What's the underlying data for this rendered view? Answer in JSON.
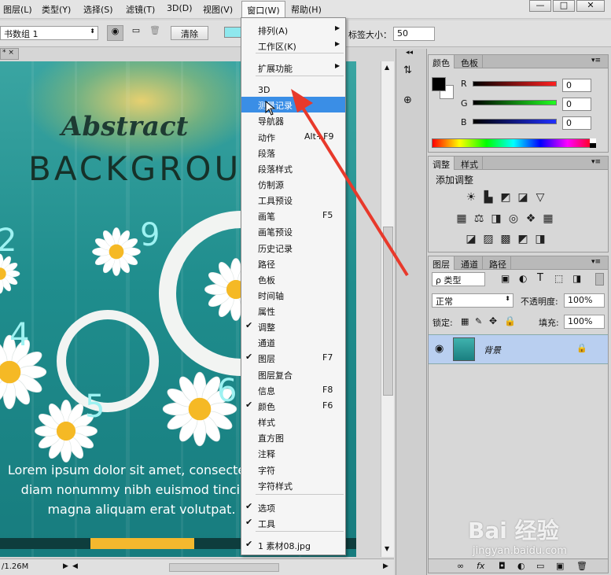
{
  "menubar": {
    "items": [
      "图层(L)",
      "类型(Y)",
      "选择(S)",
      "滤镜(T)",
      "3D(D)",
      "视图(V)",
      "窗口(W)",
      "帮助(H)"
    ],
    "window_controls": [
      "—",
      "□",
      "✕"
    ]
  },
  "options": {
    "group_value": "书数组 1",
    "clear_button": "清除",
    "tab_size_label": "标签大小：",
    "tab_size_value": "50"
  },
  "document": {
    "tab_label": "* ×",
    "status_text": "/1.26M"
  },
  "artwork": {
    "title_script": "Abstract",
    "title_block": "BACKGROUND",
    "numbers": [
      "2",
      "9",
      "4",
      "5",
      "6"
    ],
    "lorem_lines": [
      "Lorem ipsum dolor sit amet, consectetuer ad",
      "diam nonummy nibh euismod tincidunt ut",
      "magna aliquam erat volutpat."
    ]
  },
  "window_menu": {
    "items": [
      {
        "label": "排列(A)",
        "arrow": "▶"
      },
      {
        "label": "工作区(K)",
        "arrow": "▶"
      },
      {
        "label": "扩展功能",
        "arrow": "▶"
      },
      {
        "label": "3D"
      },
      {
        "label": "测量记录"
      },
      {
        "label": "导航器"
      },
      {
        "label": "动作",
        "shortcut": "Alt+F9"
      },
      {
        "label": "段落"
      },
      {
        "label": "段落样式"
      },
      {
        "label": "仿制源"
      },
      {
        "label": "工具预设"
      },
      {
        "label": "画笔",
        "shortcut": "F5"
      },
      {
        "label": "画笔预设"
      },
      {
        "label": "历史记录"
      },
      {
        "label": "路径"
      },
      {
        "label": "色板"
      },
      {
        "label": "时间轴"
      },
      {
        "label": "属性"
      },
      {
        "label": "调整",
        "check": "✔"
      },
      {
        "label": "通道"
      },
      {
        "label": "图层",
        "shortcut": "F7",
        "check": "✔"
      },
      {
        "label": "图层复合"
      },
      {
        "label": "信息",
        "shortcut": "F8"
      },
      {
        "label": "颜色",
        "shortcut": "F6",
        "check": "✔"
      },
      {
        "label": "样式"
      },
      {
        "label": "直方图"
      },
      {
        "label": "注释"
      },
      {
        "label": "字符"
      },
      {
        "label": "字符样式"
      },
      {
        "label": "选项",
        "check": "✔"
      },
      {
        "label": "工具",
        "check": "✔"
      },
      {
        "label": "1 素材08.jpg",
        "check": "✔"
      }
    ]
  },
  "color_panel": {
    "tabs": [
      "颜色",
      "色板"
    ],
    "channels": [
      {
        "label": "R",
        "value": "0",
        "color": "#e02020"
      },
      {
        "label": "G",
        "value": "0",
        "color": "#20c020"
      },
      {
        "label": "B",
        "value": "0",
        "color": "#2030e0"
      }
    ],
    "foreground": "#000000",
    "background": "#ffffff"
  },
  "adjust_panel": {
    "tabs": [
      "调整",
      "样式"
    ],
    "title": "添加调整",
    "row1": [
      "☀",
      "▙",
      "◩",
      "◪",
      "▽"
    ],
    "row2": [
      "▦",
      "⚖",
      "◨",
      "◎",
      "❖",
      "▦"
    ],
    "row3": [
      "◪",
      "▨",
      "▩",
      "◩",
      "◨"
    ]
  },
  "layers_panel": {
    "tabs": [
      "图层",
      "通道",
      "路径"
    ],
    "filter_label": "ρ 类型",
    "blend_mode": "正常",
    "opacity_label": "不透明度:",
    "opacity_value": "100%",
    "lock_label": "锁定:",
    "fill_label": "填充:",
    "fill_value": "100%",
    "layer_name": "背景",
    "footer_icons": [
      "∞",
      "fx",
      "◘",
      "◐",
      "▭",
      "▣",
      "🗑"
    ]
  },
  "watermark": {
    "brand": "Bai 经验",
    "url": "jingyan.baidu.com"
  },
  "colors": {
    "menu_highlight": "#3a8ee6",
    "arrow": "#e8392b",
    "layer_selected": "#b9cff0"
  }
}
